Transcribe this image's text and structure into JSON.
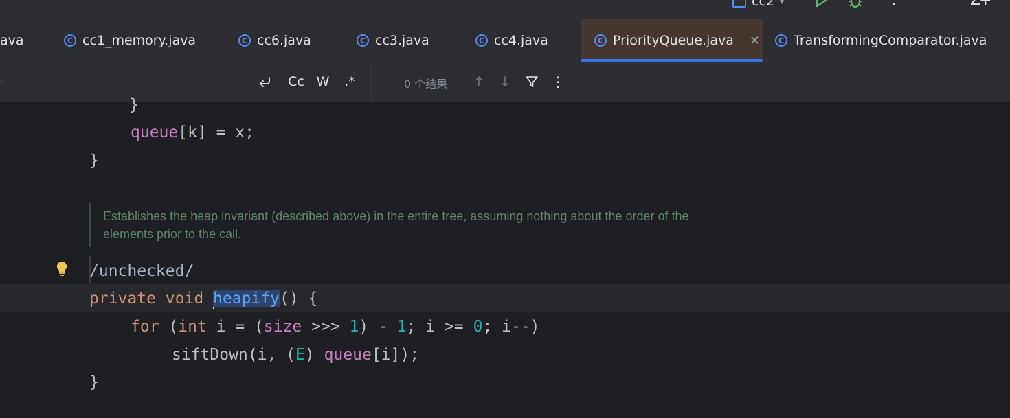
{
  "toolbar": {
    "run_config": "cc2",
    "icons": [
      "run-icon",
      "debug-icon",
      "more-icon",
      "add-icon"
    ]
  },
  "tabs": [
    {
      "label": "ava",
      "active": false,
      "icon": null
    },
    {
      "label": "cc1_memory.java",
      "active": false,
      "icon": "class-icon"
    },
    {
      "label": "cc6.java",
      "active": false,
      "icon": "class-icon"
    },
    {
      "label": "cc3.java",
      "active": false,
      "icon": "class-icon"
    },
    {
      "label": "cc4.java",
      "active": false,
      "icon": "class-icon"
    },
    {
      "label": "PriorityQueue.java",
      "active": true,
      "icon": "class-icon"
    },
    {
      "label": "TransformingComparator.java",
      "active": false,
      "icon": "class-icon"
    }
  ],
  "find_bar": {
    "newline_option": "↩",
    "match_case": "Cc",
    "words": "W",
    "regex": ".*",
    "result_text": "0 个结果"
  },
  "editor": {
    "line_brace_close": "}",
    "line_queue_assign": "queue[k] = x;",
    "line_method_close": "}",
    "doc_comment": "Establishes the heap invariant (described above) in the entire tree, assuming nothing about the order of the elements prior to the call.",
    "annotation": "/unchecked/",
    "method_decl": {
      "private": "private",
      "void": "void",
      "name": "heapify",
      "rest": "() {"
    },
    "for_line": {
      "for": "for",
      "open": " (",
      "int": "int",
      "mid": " i = (",
      "size": "size",
      "mid2": " >>> ",
      "one": "1",
      "mid3": ") - ",
      "one_b": "1",
      "mid4": "; i >= ",
      "zero": "0",
      "tail": "; i--)"
    },
    "sift_line": {
      "call": "siftDown(i, (",
      "type": "E",
      "mid": ") ",
      "queue": "queue",
      "tail": "[i]);"
    },
    "final_close": "}"
  },
  "colors": {
    "accent": "#3574f0",
    "keyword": "#cf8e6d",
    "field": "#c77dbb",
    "number": "#2aacb8",
    "function": "#56a8f5",
    "doc": "#5f826b"
  }
}
